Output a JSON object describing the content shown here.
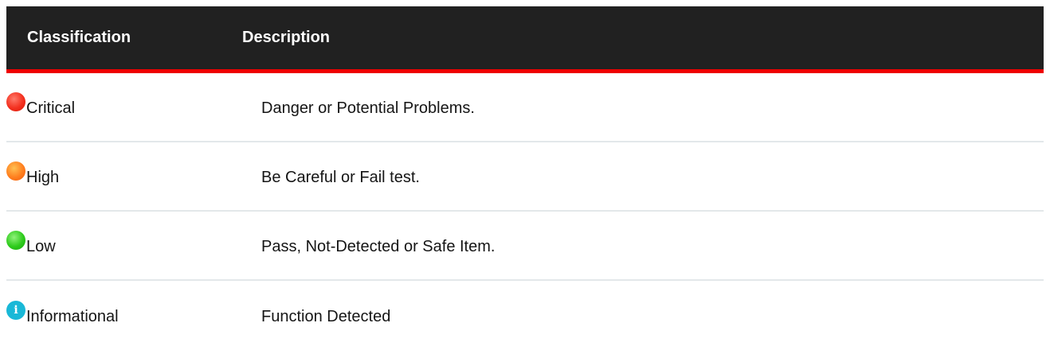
{
  "table": {
    "headers": {
      "classification": "Classification",
      "description": "Description"
    },
    "rows": [
      {
        "classification": "Critical",
        "description": "Danger or Potential Problems.",
        "icon": "critical-dot-icon",
        "color": "#f3301f"
      },
      {
        "classification": "High",
        "description": "Be Careful or Fail test.",
        "icon": "high-dot-icon",
        "color": "#ff7f1f"
      },
      {
        "classification": "Low",
        "description": "Pass, Not-Detected or Safe Item.",
        "icon": "low-dot-icon",
        "color": "#2ecb1c"
      },
      {
        "classification": "Informational",
        "description": "Function Detected",
        "icon": "info-icon",
        "color": "#19b8d7"
      }
    ]
  },
  "colors": {
    "header_bg": "#212121",
    "header_border": "#ee0000",
    "row_divider": "#e3e8ea"
  }
}
